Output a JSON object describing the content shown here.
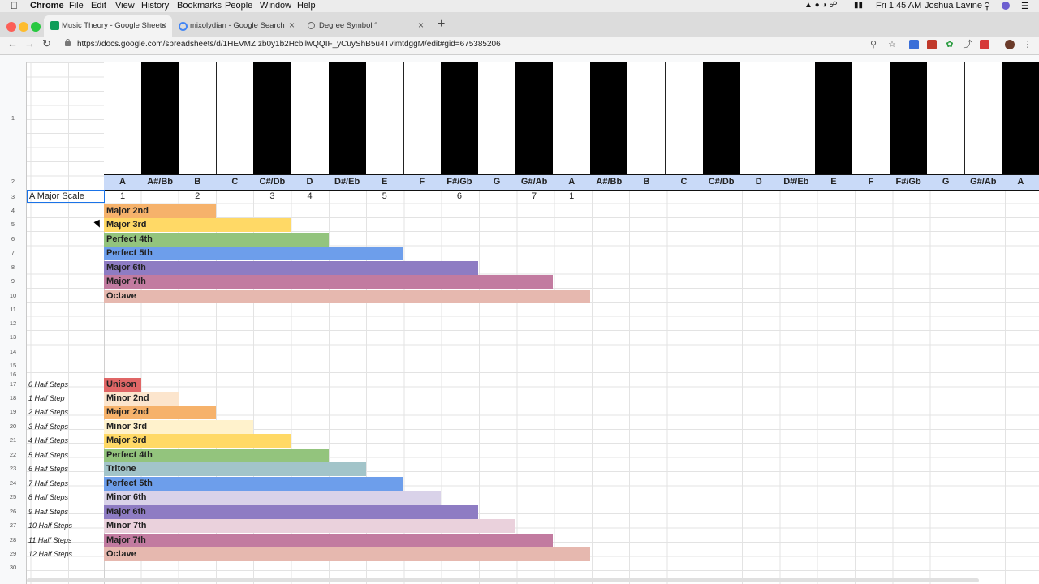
{
  "menubar": {
    "app": "Chrome",
    "items": [
      "File",
      "Edit",
      "View",
      "History",
      "Bookmarks",
      "People",
      "Window",
      "Help"
    ],
    "clock": "Fri 1:45 AM",
    "user": "Joshua Lavine"
  },
  "tabs": [
    {
      "title": "Music Theory - Google Sheets",
      "icon": "sheets-icon",
      "active": true
    },
    {
      "title": "mixolydian - Google Search",
      "icon": "google-icon",
      "active": false
    },
    {
      "title": "Degree Symbol °",
      "icon": "globe-icon",
      "active": false
    }
  ],
  "address": {
    "url": "https://docs.google.com/spreadsheets/d/1HEVMZIzb0y1b2HcbilwQQIF_yCuyShB5u4TvimtdggM/edit#gid=675385206"
  },
  "colors": {
    "notes_row": "#c9daf8",
    "selection": "#1a73e8",
    "unison": "#e06666",
    "minor2": "#fce5cd",
    "major2": "#f6b26b",
    "minor3": "#fff2cc",
    "major3": "#ffd966",
    "perfect4": "#93c47d",
    "tritone": "#a2c4c9",
    "perfect5": "#6d9eeb",
    "minor6": "#d9d2e9",
    "major6": "#8e7cc3",
    "minor7": "#ead1dc",
    "major7": "#c27ba0",
    "octave": "#e6b8af"
  },
  "sheet": {
    "row_numbers": [
      "1",
      "2",
      "3",
      "4",
      "5",
      "6",
      "7",
      "8",
      "9",
      "10",
      "11",
      "12",
      "13",
      "14",
      "15",
      "16",
      "17",
      "18",
      "19",
      "20",
      "21",
      "22",
      "23",
      "24",
      "25",
      "26",
      "27",
      "28",
      "29",
      "30"
    ],
    "piano_keys": [
      "white",
      "black",
      "white",
      "white",
      "black",
      "white",
      "black",
      "white",
      "white",
      "black",
      "white",
      "black",
      "white",
      "black",
      "white",
      "white",
      "black",
      "white",
      "white",
      "black",
      "white",
      "black",
      "white",
      "white",
      "black",
      "white"
    ],
    "notes": [
      "A",
      "A#/Bb",
      "B",
      "C",
      "C#/Db",
      "D",
      "D#/Eb",
      "E",
      "F",
      "F#/Gb",
      "G",
      "G#/Ab",
      "A",
      "A#/Bb",
      "B",
      "C",
      "C#/Db",
      "D",
      "D#/Eb",
      "E",
      "F",
      "F#/Gb",
      "G",
      "G#/Ab",
      "A"
    ],
    "scale_label": "A Major Scale",
    "scale_degrees": [
      {
        "col": 0,
        "label": "1"
      },
      {
        "col": 2,
        "label": "2"
      },
      {
        "col": 4,
        "label": "3"
      },
      {
        "col": 5,
        "label": "4"
      },
      {
        "col": 7,
        "label": "5"
      },
      {
        "col": 9,
        "label": "6"
      },
      {
        "col": 11,
        "label": "7"
      },
      {
        "col": 12,
        "label": "1"
      }
    ],
    "scale_intervals": [
      {
        "label": "Major 2nd",
        "semitones": 2,
        "color": "#f6b26b"
      },
      {
        "label": "Major 3rd",
        "semitones": 4,
        "color": "#ffd966"
      },
      {
        "label": "Perfect 4th",
        "semitones": 5,
        "color": "#93c47d"
      },
      {
        "label": "Perfect 5th",
        "semitones": 7,
        "color": "#6d9eeb"
      },
      {
        "label": "Major 6th",
        "semitones": 9,
        "color": "#8e7cc3"
      },
      {
        "label": "Major 7th",
        "semitones": 11,
        "color": "#c27ba0"
      },
      {
        "label": "Octave",
        "semitones": 12,
        "color": "#e6b8af"
      }
    ],
    "all_intervals": [
      {
        "steps": "0 Half Steps",
        "label": "Unison",
        "semitones": 0,
        "color": "#e06666"
      },
      {
        "steps": "1 Half Step",
        "label": "Minor 2nd",
        "semitones": 1,
        "color": "#fce5cd"
      },
      {
        "steps": "2 Half Steps",
        "label": "Major 2nd",
        "semitones": 2,
        "color": "#f6b26b"
      },
      {
        "steps": "3 Half Steps",
        "label": "Minor 3rd",
        "semitones": 3,
        "color": "#fff2cc"
      },
      {
        "steps": "4 Half Steps",
        "label": "Major 3rd",
        "semitones": 4,
        "color": "#ffd966"
      },
      {
        "steps": "5 Half Steps",
        "label": "Perfect 4th",
        "semitones": 5,
        "color": "#93c47d"
      },
      {
        "steps": "6 Half Steps",
        "label": "Tritone",
        "semitones": 6,
        "color": "#a2c4c9"
      },
      {
        "steps": "7 Half Steps",
        "label": "Perfect 5th",
        "semitones": 7,
        "color": "#6d9eeb"
      },
      {
        "steps": "8 Half Steps",
        "label": "Minor 6th",
        "semitones": 8,
        "color": "#d9d2e9"
      },
      {
        "steps": "9 Half Steps",
        "label": "Major 6th",
        "semitones": 9,
        "color": "#8e7cc3"
      },
      {
        "steps": "10 Half Steps",
        "label": "Minor 7th",
        "semitones": 10,
        "color": "#ead1dc"
      },
      {
        "steps": "11 Half Steps",
        "label": "Major 7th",
        "semitones": 11,
        "color": "#c27ba0"
      },
      {
        "steps": "12 Half Steps",
        "label": "Octave",
        "semitones": 12,
        "color": "#e6b8af"
      }
    ]
  }
}
